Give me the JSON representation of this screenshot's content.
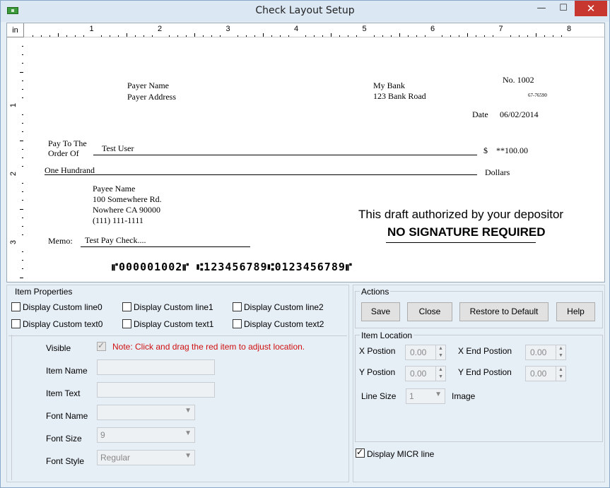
{
  "window": {
    "title": "Check Layout Setup",
    "minimize": "—",
    "maximize": "☐",
    "close": "✕"
  },
  "ruler": {
    "unit": "in",
    "top_numbers": [
      "1",
      "2",
      "3",
      "4",
      "5",
      "6",
      "7",
      "8"
    ],
    "left_numbers": [
      "1",
      "2",
      "3"
    ]
  },
  "check": {
    "payer_name": "Payer Name",
    "payer_address": "Payer Address",
    "bank_name": "My Bank",
    "bank_address": "123 Bank Road",
    "check_no": "No. 1002",
    "routing_fraction": "67-76590",
    "date_label": "Date",
    "date_value": "06/02/2014",
    "pay_to_line1": "Pay To The",
    "pay_to_line2": "Order Of",
    "payee": "Test User",
    "dollar_sign": "$",
    "amount": "**100.00",
    "amount_words": "One Hundrand",
    "dollars_label": "Dollars",
    "payee_name": "Payee Name",
    "payee_address1": "100 Somewhere Rd.",
    "payee_address2": "Nowhere CA 90000",
    "payee_phone": "(111) 111-1111",
    "memo_label": "Memo:",
    "memo_value": "Test Pay Check....",
    "auth_line1": "This draft authorized by your depositor",
    "auth_line2": "NO SIGNATURE REQUIRED",
    "micr": "⑈000001002⑈ ⑆123456789⑆0123456789⑈"
  },
  "item_properties": {
    "title": "Item Properties",
    "checkboxes": [
      {
        "label": "Display Custom line0",
        "checked": false
      },
      {
        "label": "Display Custom line1",
        "checked": false
      },
      {
        "label": "Display Custom line2",
        "checked": false
      },
      {
        "label": "Display Custom text0",
        "checked": false
      },
      {
        "label": "Display Custom text1",
        "checked": false
      },
      {
        "label": "Display Custom text2",
        "checked": false
      }
    ],
    "visible_label": "Visible",
    "note": "Note: Click and drag the red item to adjust location.",
    "item_name_label": "Item Name",
    "item_text_label": "Item Text",
    "font_name_label": "Font Name",
    "font_size_label": "Font Size",
    "font_size_value": "9",
    "font_style_label": "Font Style",
    "font_style_value": "Regular"
  },
  "actions": {
    "title": "Actions",
    "save": "Save",
    "close": "Close",
    "restore": "Restore to Default",
    "help": "Help"
  },
  "item_location": {
    "title": "Item Location",
    "x_label": "X Postion",
    "x_value": "0.00",
    "x_end_label": "X End Postion",
    "x_end_value": "0.00",
    "y_label": "Y Postion",
    "y_value": "0.00",
    "y_end_label": "Y End Postion",
    "y_end_value": "0.00",
    "line_size_label": "Line Size",
    "line_size_value": "1",
    "image_label": "Image"
  },
  "micr_option": {
    "label": "Display MICR line",
    "checked": true
  }
}
